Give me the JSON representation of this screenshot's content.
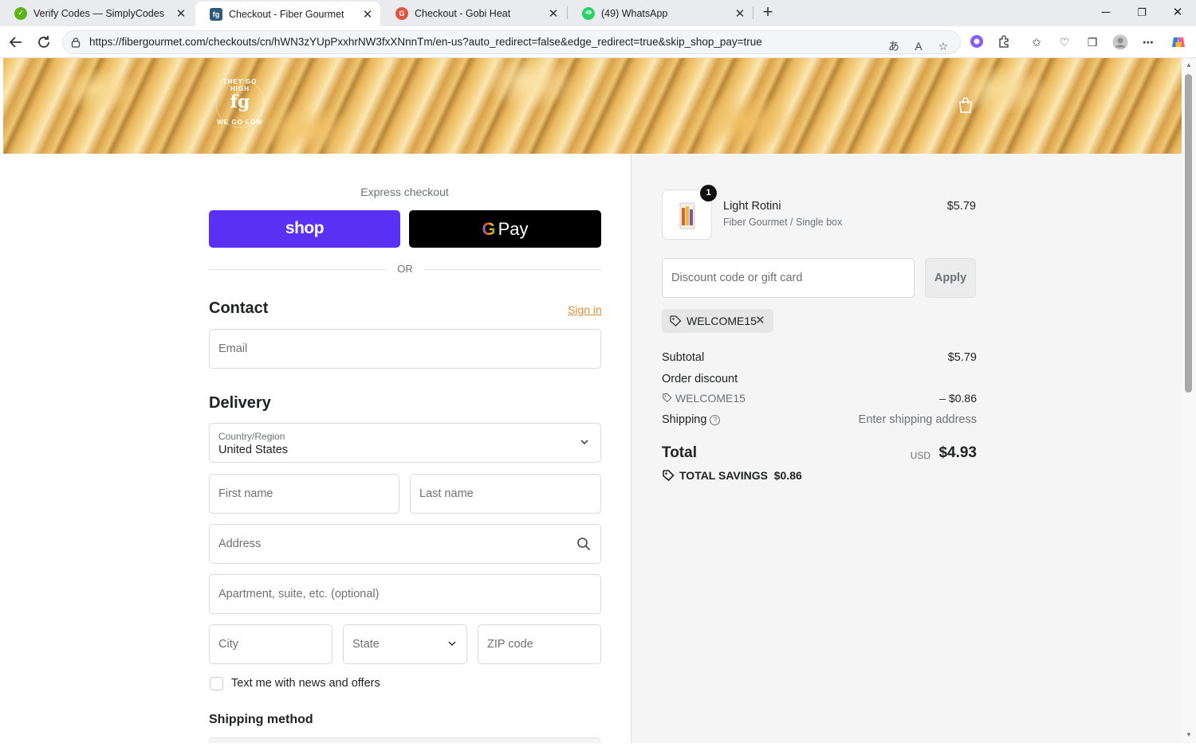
{
  "browser": {
    "tabs": [
      {
        "title": "Verify Codes — SimplyCodes",
        "favicon_color": "#5bb318",
        "favicon_glyph": "✓"
      },
      {
        "title": "Checkout - Fiber Gourmet",
        "favicon_color": "#2d5d7b",
        "favicon_glyph": "fg"
      },
      {
        "title": "Checkout - Gobi Heat",
        "favicon_color": "#e2543c",
        "favicon_glyph": "G"
      },
      {
        "title": "(49) WhatsApp",
        "favicon_color": "#25d366",
        "favicon_glyph": "49"
      }
    ],
    "active_tab_index": 1,
    "new_tab_label": "+",
    "url": "https://fibergourmet.com/checkouts/cn/hWN3zYUpPxxhrNW3fxXNnnTm/en-us?auto_redirect=false&edge_redirect=true&skip_shop_pay=true",
    "window_controls": {
      "minimize": "─",
      "restore": "❐",
      "close": "✕"
    }
  },
  "express": {
    "label": "Express checkout",
    "shop_pay_label": "shop",
    "gpay_label": "Pay",
    "or_label": "OR"
  },
  "contact": {
    "heading": "Contact",
    "sign_in": "Sign in",
    "email_placeholder": "Email"
  },
  "delivery": {
    "heading": "Delivery",
    "country_label": "Country/Region",
    "country_value": "United States",
    "first_name_placeholder": "First name",
    "last_name_placeholder": "Last name",
    "address_placeholder": "Address",
    "apartment_placeholder": "Apartment, suite, etc. (optional)",
    "city_placeholder": "City",
    "state_placeholder": "State",
    "zip_placeholder": "ZIP code",
    "text_offers_label": "Text me with news and offers",
    "text_offers_checked": false
  },
  "shipping_method": {
    "heading": "Shipping method"
  },
  "summary": {
    "product": {
      "quantity": "1",
      "name": "Light Rotini",
      "variant": "Fiber Gourmet / Single box",
      "price": "$5.79"
    },
    "discount_placeholder": "Discount code or gift card",
    "apply_label": "Apply",
    "applied_code": "WELCOME15",
    "subtotal_label": "Subtotal",
    "subtotal_value": "$5.79",
    "order_discount_label": "Order discount",
    "order_discount_code": "WELCOME15",
    "order_discount_value": "– $0.86",
    "shipping_label": "Shipping",
    "shipping_value": "Enter shipping address",
    "total_label": "Total",
    "total_currency": "USD",
    "total_value": "$4.93",
    "savings_label": "TOTAL SAVINGS",
    "savings_value": "$0.86"
  },
  "brand": {
    "logo_monogram": "fg",
    "logo_arc_top": "THEY GO HIGH",
    "logo_arc_bottom": "WE GO LOW",
    "accent_link_color": "#e08b3a",
    "shop_pay_color": "#5a31f4"
  }
}
